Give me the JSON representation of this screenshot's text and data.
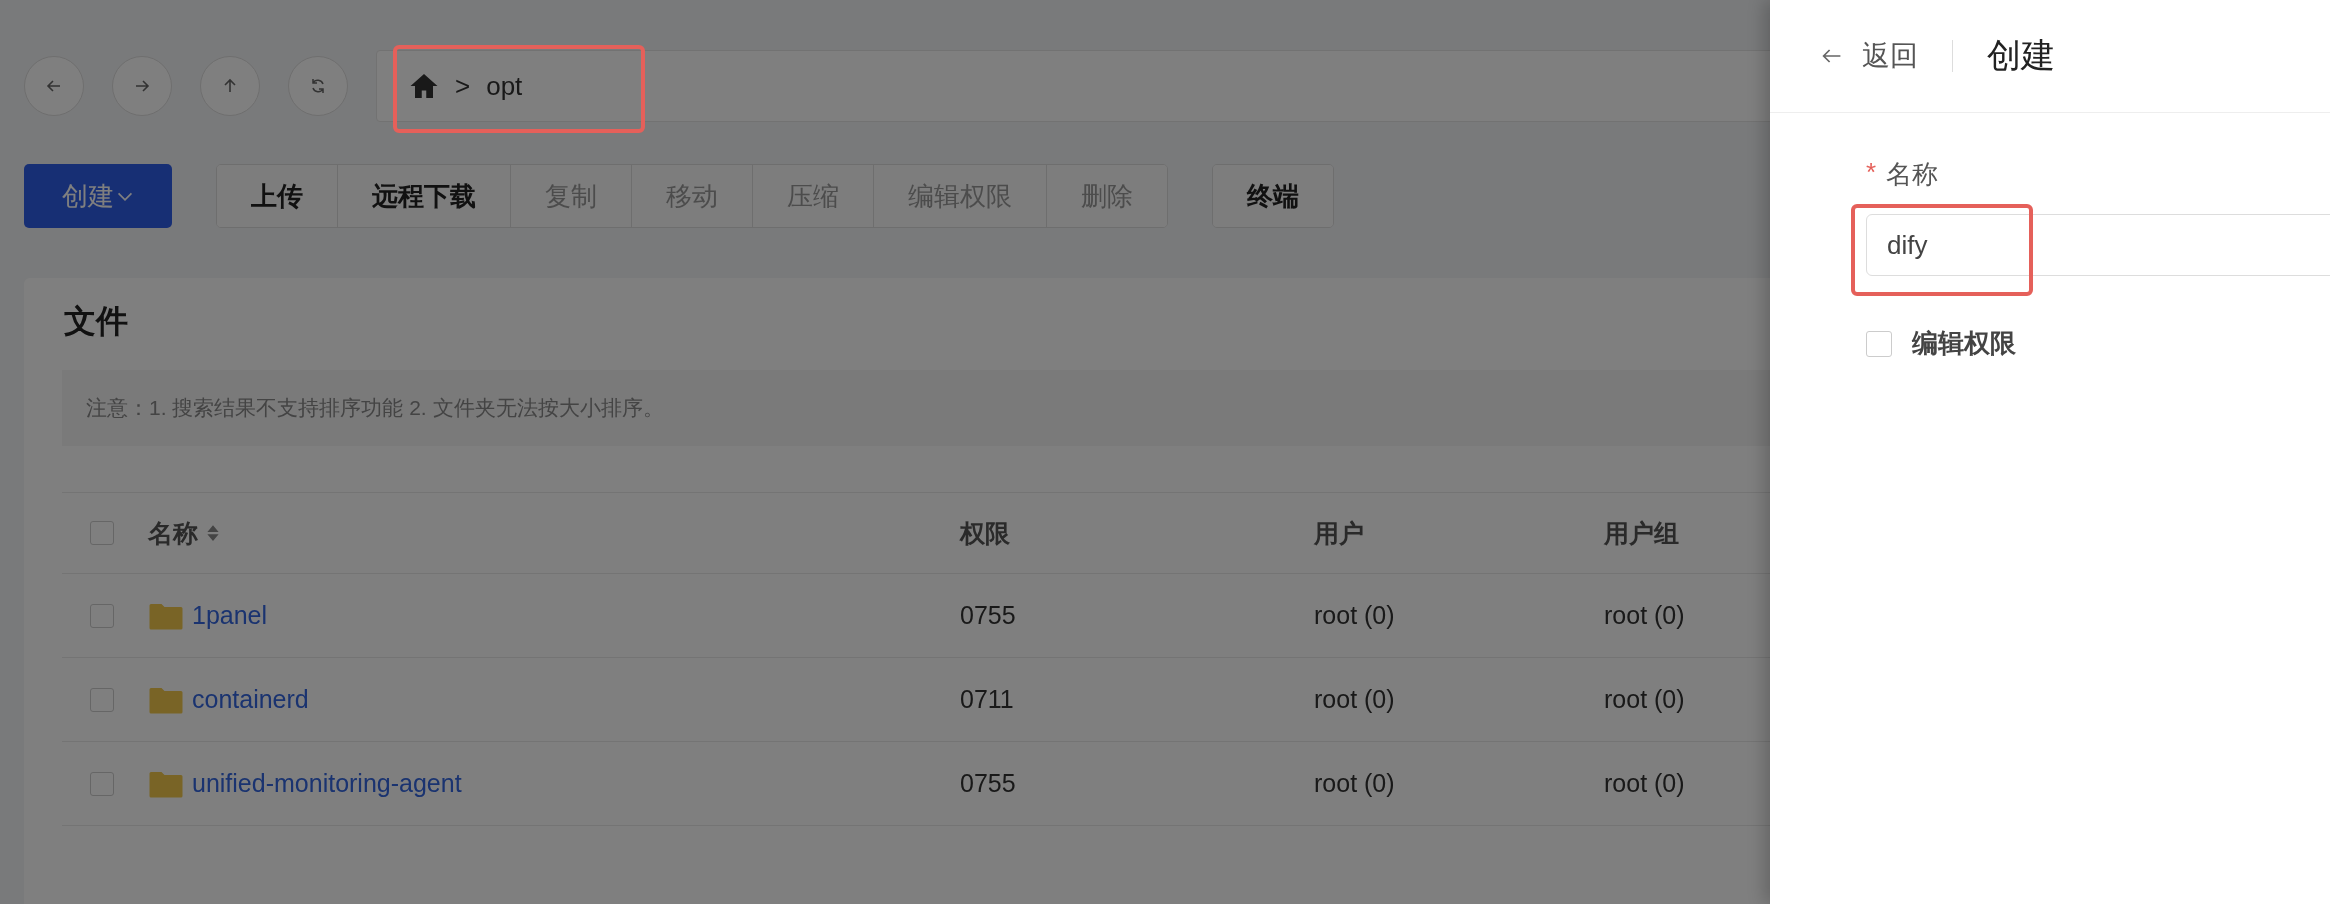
{
  "breadcrumb": {
    "separator": ">",
    "path": [
      "opt"
    ]
  },
  "toolbar": {
    "create": {
      "label": "创建"
    },
    "groups": [
      [
        {
          "label": "上传",
          "disabled": false
        },
        {
          "label": "远程下载",
          "disabled": false
        },
        {
          "label": "复制",
          "disabled": true
        },
        {
          "label": "移动",
          "disabled": true
        },
        {
          "label": "压缩",
          "disabled": true
        },
        {
          "label": "编辑权限",
          "disabled": true
        },
        {
          "label": "删除",
          "disabled": true
        }
      ],
      [
        {
          "label": "终端",
          "disabled": false
        }
      ]
    ]
  },
  "files": {
    "title": "文件",
    "notice": "注意：1. 搜索结果不支持排序功能 2. 文件夹无法按大小排序。",
    "select_all": {
      "checked": false
    },
    "columns": [
      "名称",
      "权限",
      "用户",
      "用户组"
    ],
    "rows": [
      {
        "name": "1panel",
        "permission": "0755",
        "user": "root (0)",
        "group": "root (0)",
        "checked": false
      },
      {
        "name": "containerd",
        "permission": "0711",
        "user": "root (0)",
        "group": "root (0)",
        "checked": false
      },
      {
        "name": "unified-monitoring-agent",
        "permission": "0755",
        "user": "root (0)",
        "group": "root (0)",
        "checked": false
      }
    ]
  },
  "drawer": {
    "back": "返回",
    "title": "创建",
    "name_field": {
      "required_mark": "*",
      "label": "名称",
      "value": "dify"
    },
    "edit_permission": {
      "label": "编辑权限",
      "checked": false
    }
  }
}
